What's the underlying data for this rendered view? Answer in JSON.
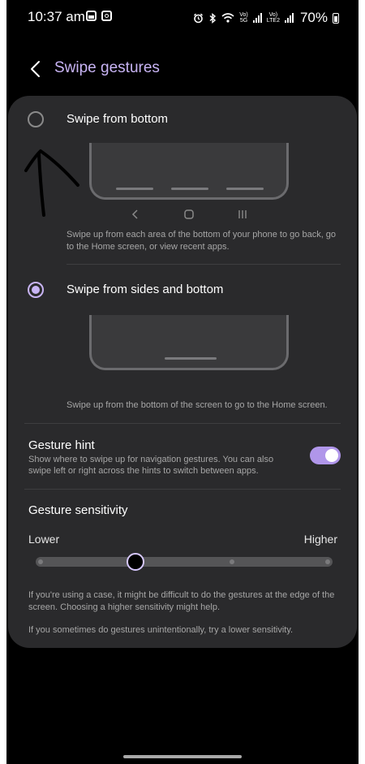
{
  "status_bar": {
    "time": "10:37 am",
    "battery": "70%",
    "volte1": "Vo)",
    "net1": "5G",
    "volte2": "Vo)",
    "net2": "LTE2"
  },
  "header": {
    "title": "Swipe gestures"
  },
  "options": [
    {
      "label": "Swipe from bottom",
      "selected": false,
      "description": "Swipe up from each area of the bottom of your phone to go back, go to the Home screen, or view recent apps."
    },
    {
      "label": "Swipe from sides and bottom",
      "selected": true,
      "description": "Swipe up from the bottom of the screen to go to the Home screen."
    }
  ],
  "nav_icons": [
    "back-icon",
    "home-icon",
    "recents-icon"
  ],
  "gesture_hint": {
    "title": "Gesture hint",
    "description": "Show where to swipe up for navigation gestures. You can also swipe left or right across the hints to switch between apps.",
    "enabled": true
  },
  "sensitivity": {
    "title": "Gesture sensitivity",
    "lower_label": "Lower",
    "higher_label": "Higher",
    "level_fraction": 0.33,
    "note1": "If you're using a case, it might be difficult to do the gestures at the edge of the screen. Choosing a higher sensitivity might help.",
    "note2": "If you sometimes do gestures unintentionally, try a lower sensitivity."
  },
  "colors": {
    "accent": "#c8b4f4",
    "card": "#2a2a2c",
    "background": "#000000"
  }
}
